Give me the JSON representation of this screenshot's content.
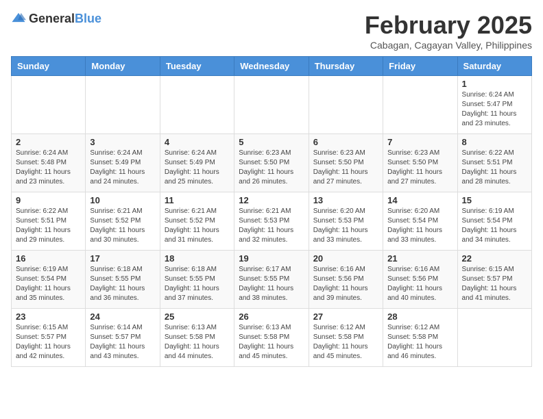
{
  "logo": {
    "general": "General",
    "blue": "Blue"
  },
  "header": {
    "month": "February 2025",
    "location": "Cabagan, Cagayan Valley, Philippines"
  },
  "weekdays": [
    "Sunday",
    "Monday",
    "Tuesday",
    "Wednesday",
    "Thursday",
    "Friday",
    "Saturday"
  ],
  "weeks": [
    [
      {
        "day": null,
        "info": null
      },
      {
        "day": null,
        "info": null
      },
      {
        "day": null,
        "info": null
      },
      {
        "day": null,
        "info": null
      },
      {
        "day": null,
        "info": null
      },
      {
        "day": null,
        "info": null
      },
      {
        "day": "1",
        "info": "Sunrise: 6:24 AM\nSunset: 5:47 PM\nDaylight: 11 hours and 23 minutes."
      }
    ],
    [
      {
        "day": "2",
        "info": "Sunrise: 6:24 AM\nSunset: 5:48 PM\nDaylight: 11 hours and 23 minutes."
      },
      {
        "day": "3",
        "info": "Sunrise: 6:24 AM\nSunset: 5:49 PM\nDaylight: 11 hours and 24 minutes."
      },
      {
        "day": "4",
        "info": "Sunrise: 6:24 AM\nSunset: 5:49 PM\nDaylight: 11 hours and 25 minutes."
      },
      {
        "day": "5",
        "info": "Sunrise: 6:23 AM\nSunset: 5:50 PM\nDaylight: 11 hours and 26 minutes."
      },
      {
        "day": "6",
        "info": "Sunrise: 6:23 AM\nSunset: 5:50 PM\nDaylight: 11 hours and 27 minutes."
      },
      {
        "day": "7",
        "info": "Sunrise: 6:23 AM\nSunset: 5:50 PM\nDaylight: 11 hours and 27 minutes."
      },
      {
        "day": "8",
        "info": "Sunrise: 6:22 AM\nSunset: 5:51 PM\nDaylight: 11 hours and 28 minutes."
      }
    ],
    [
      {
        "day": "9",
        "info": "Sunrise: 6:22 AM\nSunset: 5:51 PM\nDaylight: 11 hours and 29 minutes."
      },
      {
        "day": "10",
        "info": "Sunrise: 6:21 AM\nSunset: 5:52 PM\nDaylight: 11 hours and 30 minutes."
      },
      {
        "day": "11",
        "info": "Sunrise: 6:21 AM\nSunset: 5:52 PM\nDaylight: 11 hours and 31 minutes."
      },
      {
        "day": "12",
        "info": "Sunrise: 6:21 AM\nSunset: 5:53 PM\nDaylight: 11 hours and 32 minutes."
      },
      {
        "day": "13",
        "info": "Sunrise: 6:20 AM\nSunset: 5:53 PM\nDaylight: 11 hours and 33 minutes."
      },
      {
        "day": "14",
        "info": "Sunrise: 6:20 AM\nSunset: 5:54 PM\nDaylight: 11 hours and 33 minutes."
      },
      {
        "day": "15",
        "info": "Sunrise: 6:19 AM\nSunset: 5:54 PM\nDaylight: 11 hours and 34 minutes."
      }
    ],
    [
      {
        "day": "16",
        "info": "Sunrise: 6:19 AM\nSunset: 5:54 PM\nDaylight: 11 hours and 35 minutes."
      },
      {
        "day": "17",
        "info": "Sunrise: 6:18 AM\nSunset: 5:55 PM\nDaylight: 11 hours and 36 minutes."
      },
      {
        "day": "18",
        "info": "Sunrise: 6:18 AM\nSunset: 5:55 PM\nDaylight: 11 hours and 37 minutes."
      },
      {
        "day": "19",
        "info": "Sunrise: 6:17 AM\nSunset: 5:55 PM\nDaylight: 11 hours and 38 minutes."
      },
      {
        "day": "20",
        "info": "Sunrise: 6:16 AM\nSunset: 5:56 PM\nDaylight: 11 hours and 39 minutes."
      },
      {
        "day": "21",
        "info": "Sunrise: 6:16 AM\nSunset: 5:56 PM\nDaylight: 11 hours and 40 minutes."
      },
      {
        "day": "22",
        "info": "Sunrise: 6:15 AM\nSunset: 5:57 PM\nDaylight: 11 hours and 41 minutes."
      }
    ],
    [
      {
        "day": "23",
        "info": "Sunrise: 6:15 AM\nSunset: 5:57 PM\nDaylight: 11 hours and 42 minutes."
      },
      {
        "day": "24",
        "info": "Sunrise: 6:14 AM\nSunset: 5:57 PM\nDaylight: 11 hours and 43 minutes."
      },
      {
        "day": "25",
        "info": "Sunrise: 6:13 AM\nSunset: 5:58 PM\nDaylight: 11 hours and 44 minutes."
      },
      {
        "day": "26",
        "info": "Sunrise: 6:13 AM\nSunset: 5:58 PM\nDaylight: 11 hours and 45 minutes."
      },
      {
        "day": "27",
        "info": "Sunrise: 6:12 AM\nSunset: 5:58 PM\nDaylight: 11 hours and 45 minutes."
      },
      {
        "day": "28",
        "info": "Sunrise: 6:12 AM\nSunset: 5:58 PM\nDaylight: 11 hours and 46 minutes."
      },
      {
        "day": null,
        "info": null
      }
    ]
  ]
}
